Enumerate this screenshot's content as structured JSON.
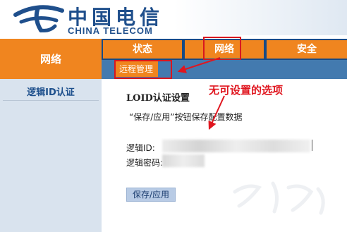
{
  "header": {
    "brand_cn": "中国电信",
    "brand_en": "CHINA TELECOM",
    "logo_icon": "china-telecom-logo-icon"
  },
  "left_nav": {
    "title": "网络"
  },
  "tabs": [
    {
      "label": "状态",
      "selected": false
    },
    {
      "label": "网络",
      "selected": true
    },
    {
      "label": "安全",
      "selected": false
    }
  ],
  "subnav": {
    "item": "远程管理"
  },
  "sidebar": {
    "item": "逻辑ID认证"
  },
  "content": {
    "title": "LOID认证设置",
    "help": "“保存/应用”按钮保存配置数据",
    "label_id": "逻辑ID:",
    "label_password": "逻辑密码:",
    "save_label": "保存/应用"
  },
  "annotation": {
    "text": "无可设置的选项"
  },
  "colors": {
    "brand_blue": "#1f4f8c",
    "nav_orange": "#f0851f",
    "nav_dark_blue": "#174a85",
    "subnav_blue": "#437aaf",
    "annotation_red": "#e0161f",
    "sidebar_bg": "#d9e3ee"
  }
}
